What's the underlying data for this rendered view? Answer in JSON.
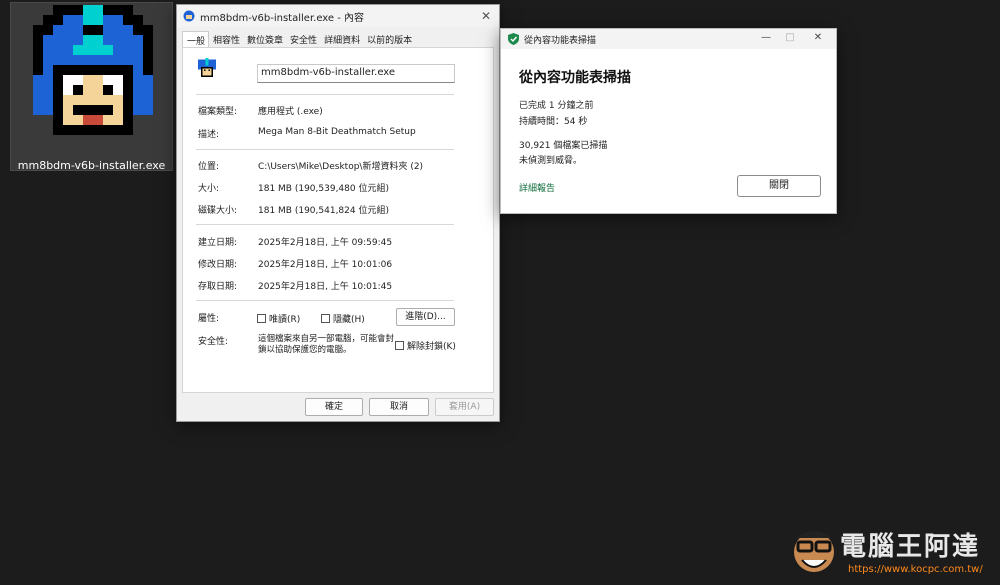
{
  "desktop": {
    "icon_label": "mm8bdm-v6b-installer.exe",
    "icon_name": "megaman-icon"
  },
  "props": {
    "title": "mm8bdm-v6b-installer.exe - 內容",
    "tabs": [
      "一般",
      "相容性",
      "數位簽章",
      "安全性",
      "詳細資料",
      "以前的版本"
    ],
    "filename": "mm8bdm-v6b-installer.exe",
    "file_type_label": "檔案類型:",
    "file_type": "應用程式 (.exe)",
    "desc_label": "描述:",
    "desc": "Mega Man 8-Bit Deathmatch Setup",
    "location_label": "位置:",
    "location": "C:\\Users\\Mike\\Desktop\\新增資料夾 (2)",
    "size_label": "大小:",
    "size": "181 MB (190,539,480 位元組)",
    "disk_label": "磁碟大小:",
    "disk": "181 MB (190,541,824 位元組)",
    "created_label": "建立日期:",
    "created": "2025年2月18日, 上午 09:59:45",
    "modified_label": "修改日期:",
    "modified": "2025年2月18日, 上午 10:01:06",
    "accessed_label": "存取日期:",
    "accessed": "2025年2月18日, 上午 10:01:45",
    "attr_label": "屬性:",
    "readonly": "唯讀(R)",
    "hidden": "隱藏(H)",
    "advanced": "進階(D)...",
    "security_label": "安全性:",
    "security_text_1": "這個檔案來自另一部電腦，可能會封",
    "security_text_2": "鎖以協助保護您的電腦。",
    "unblock": "解除封鎖(K)",
    "ok": "確定",
    "cancel": "取消",
    "apply": "套用(A)"
  },
  "scan": {
    "title": "從內容功能表掃描",
    "heading": "從內容功能表掃描",
    "completed": "已完成 1 分鐘之前",
    "duration": "持續時間：54 秒",
    "scanned": "30,921 個檔案已掃描",
    "result": "未偵測到威脅。",
    "details": "詳細報告",
    "close": "關閉",
    "minimize": "—",
    "maximize": "□",
    "close_x": "✕"
  },
  "watermark": {
    "brand": "電腦王阿達",
    "url": "https://www.kocpc.com.tw/"
  },
  "colors": {
    "megaman_blue": "#1e63d6",
    "megaman_cyan": "#00d0d0",
    "skin": "#f5d49a",
    "link_green": "#0f6b3a",
    "watermark_orange": "#ff8a1c"
  }
}
